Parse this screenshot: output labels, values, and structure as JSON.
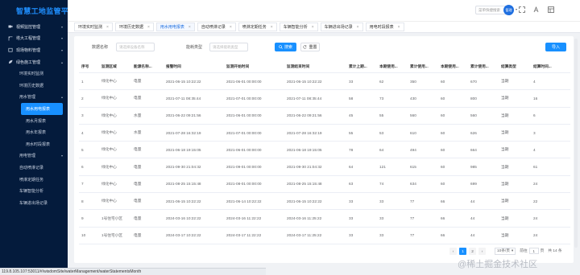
{
  "app": {
    "title": "智慧工地监管平台"
  },
  "statusbar": {
    "url": "119.8.105.107:53011/#/wisdomSite/waterManagement/waterStatementsMonth"
  },
  "header": {
    "search_placeholder": "菜单快捷搜索",
    "user": "管理"
  },
  "sidebar": {
    "items": [
      {
        "label": "视频监控管理",
        "level": "group",
        "icon": "camera-icon"
      },
      {
        "label": "塔大工程管理",
        "level": "group",
        "icon": "crane-icon"
      },
      {
        "label": "现场物料管理",
        "level": "group",
        "icon": "box-icon"
      },
      {
        "label": "绿色施工管理",
        "level": "group",
        "icon": "leaf-icon",
        "expanded": true
      },
      {
        "label": "环境实时监测",
        "level": "sub"
      },
      {
        "label": "环境历史数据",
        "level": "sub"
      },
      {
        "label": "用水管理",
        "level": "sub",
        "expanded": true
      },
      {
        "label": "用水用电报表",
        "level": "sub3",
        "active": true
      },
      {
        "label": "用水月报表",
        "level": "sub3"
      },
      {
        "label": "用水年报表",
        "level": "sub3"
      },
      {
        "label": "用水时段报表",
        "level": "sub3"
      },
      {
        "label": "用电管理",
        "level": "sub"
      },
      {
        "label": "自动喷淋记录",
        "level": "sub"
      },
      {
        "label": "喷淋定期任务",
        "level": "sub"
      },
      {
        "label": "车辆智能分析",
        "level": "sub"
      },
      {
        "label": "车辆进出场记录",
        "level": "sub"
      }
    ]
  },
  "tabs": [
    {
      "label": "环境实时监测",
      "active": false
    },
    {
      "label": "环境历史数据",
      "active": false
    },
    {
      "label": "用水用电报表",
      "active": true
    },
    {
      "label": "自动喷淋记录",
      "active": false
    },
    {
      "label": "喷淋定期任务",
      "active": false
    },
    {
      "label": "车辆智能分析",
      "active": false
    },
    {
      "label": "车辆进出场记录",
      "active": false
    },
    {
      "label": "用电时段报表",
      "active": false
    }
  ],
  "filter": {
    "device_label": "数据名称",
    "device_placeholder": "请选择设备名称",
    "type_label": "能耗类型",
    "type_placeholder": "请选择能耗类型",
    "search_label": "搜索",
    "reset_label": "重置",
    "export_label": "导入"
  },
  "table": {
    "columns": [
      "序号",
      "监测区域",
      "能源名称...",
      "报警时间",
      "监测开始时间",
      "监测结束时间",
      "累计上期...",
      "本期使用...",
      "累计使用...",
      "本期使用...",
      "累计使用...",
      "结算类型",
      "结算时间..."
    ],
    "rows": [
      [
        "1",
        "绿化中心",
        "电量",
        "2021-06-15 10:22:22",
        "2021-06-01 00:00:00",
        "2021-06-15 10:22:22",
        "33",
        "62",
        "350",
        "60",
        "670",
        "当期",
        "4"
      ],
      [
        "2",
        "绿化中心",
        "电量",
        "2021-07-11 08:35:44",
        "2021-07-01 00:00:00",
        "2021-07-11 08:35:44",
        "58",
        "73",
        "430",
        "60",
        "800",
        "当期",
        "16"
      ],
      [
        "3",
        "绿化中心",
        "水量",
        "2021-06-22 09:21:56",
        "2021-06-01 00:00:00",
        "2021-06-22 09:21:56",
        "45",
        "55",
        "560",
        "60",
        "560",
        "当期",
        "6"
      ],
      [
        "4",
        "绿化中心",
        "水量",
        "2021-07-28 16:32:19",
        "2021-07-01 00:00:00",
        "2021-07-28 16:32:19",
        "55",
        "53",
        "610",
        "60",
        "626",
        "当期",
        "3"
      ],
      [
        "5",
        "绿化中心",
        "电量",
        "2021-06-18 19:15:05",
        "2021-06-01 00:00:00",
        "2021-06-18 19:15:05",
        "78",
        "64",
        "494",
        "60",
        "664",
        "当期",
        "4"
      ],
      [
        "6",
        "绿化中心",
        "电量",
        "2021-09-30 21:04:32",
        "2021-09-01 00:00:00",
        "2021-09-30 21:04:32",
        "64",
        "121",
        "615",
        "60",
        "985",
        "当期",
        "61"
      ],
      [
        "7",
        "绿化中心",
        "电量",
        "2021-08-25 15:15:48",
        "2021-08-01 00:00:00",
        "2021-08-25 15:15:48",
        "63",
        "74",
        "634",
        "60",
        "699",
        "当期",
        "24"
      ],
      [
        "8",
        "绿化中心",
        "电量",
        "2021-06-15 10:22:22",
        "2021-06-14 10:22:22",
        "2021-06-15 10:22:22",
        "33",
        "33",
        "77",
        "66",
        "44",
        "当期",
        "22"
      ],
      [
        "9",
        "1号住宅小区",
        "电量",
        "2024-03-16 10:22:22",
        "2024-03-16 11:22:22",
        "2024-03-16 11:25:22",
        "33",
        "33",
        "77",
        "66",
        "44",
        "当期",
        "24"
      ],
      [
        "10",
        "1号住宅小区",
        "电量",
        "2024-03-17 10:22:22",
        "2024-03-17 11:22:22",
        "2024-03-17 11:25:22",
        "33",
        "33",
        "77",
        "66",
        "44",
        "当期",
        "24"
      ]
    ]
  },
  "pagination": {
    "pages": [
      "1",
      "2"
    ],
    "active_page": "1",
    "page_size": "10条/页",
    "jump_prefix": "前往",
    "jump_value": "1",
    "jump_suffix": "页",
    "total": "共 14 条"
  },
  "watermark": {
    "text": "@稀土掘金技术社区"
  }
}
